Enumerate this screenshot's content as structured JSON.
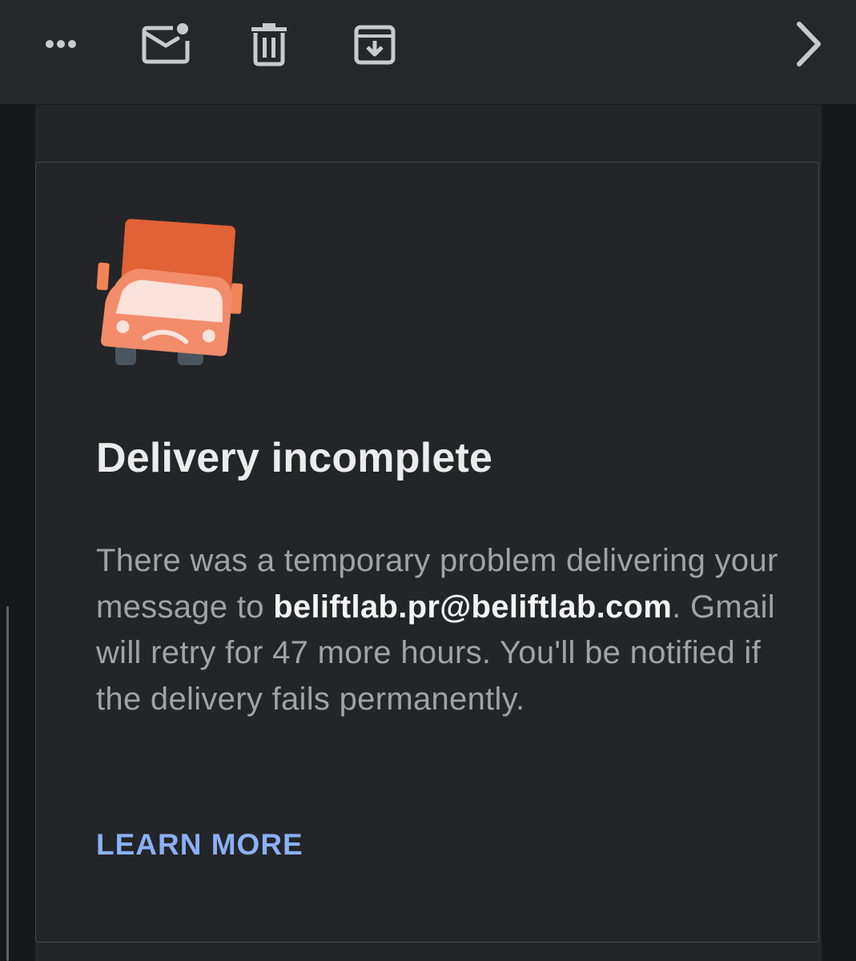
{
  "toolbar": {
    "icons": [
      "more-icon",
      "mark-unread-icon",
      "trash-icon",
      "archive-icon",
      "chevron-right-icon"
    ]
  },
  "message": {
    "title": "Delivery incomplete",
    "body_before": "There was a temporary problem delivering your message to ",
    "recipient": "beliftlab.pr@beliftlab.com",
    "body_after": ". Gmail will retry for 47 more hours. You'll be notified if the delivery fails permanently.",
    "learn_more": "LEARN MORE"
  },
  "colors": {
    "accent_link": "#8ab0f5",
    "truck_orange": "#e06236",
    "background": "#242528"
  }
}
